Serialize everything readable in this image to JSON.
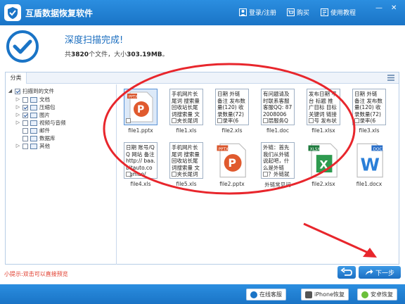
{
  "app": {
    "title": "互盾数据恢复软件"
  },
  "toolbar": {
    "login": "登录/注册",
    "buy": "购买",
    "tutorial": "使用教程"
  },
  "status": {
    "title": "深度扫描完成!",
    "prefix": "共",
    "file_count": "3820",
    "mid": "个文件，大小",
    "size": "303.19MB",
    "suffix": "。"
  },
  "tabs": {
    "category": "分类"
  },
  "tree": {
    "root": "扫描到的文件",
    "items": [
      "文档",
      "压缩包",
      "图片",
      "视频与音频",
      "邮件",
      "数据库",
      "其他"
    ]
  },
  "files": [
    {
      "name": "file1.pptx",
      "type": "pptx",
      "snippet": ""
    },
    {
      "name": "file1.xls",
      "type": "text",
      "snippet": "手机网片长尾词 搜索量 回收站长尾词搜索量 文件夹长尾词"
    },
    {
      "name": "file2.xls",
      "type": "text",
      "snippet": "日期 外链 备注 发布数量(120) 收录数量(72) 收录率(6"
    },
    {
      "name": "file1.doc",
      "type": "text",
      "snippet": "有问题请及时联系客服 客服QQ: 872008006 三层服务QQ:"
    },
    {
      "name": "file1.xlsx",
      "type": "text",
      "snippet": "发布日期 平台 标题 推广目标 目标关键词 链接 账号 发布状态"
    },
    {
      "name": "file3.xls",
      "type": "text",
      "snippet": "日期 外链 备注 发布数量(120) 收录数量(72) 收录率(6"
    },
    {
      "name": "file4.xls",
      "type": "text",
      "snippet": "日期 账号/QQ 网站 备注 http:// baa.bitauto.co ngmao/"
    },
    {
      "name": "file5.xls",
      "type": "text",
      "snippet": "手机网片长尾词 搜索量 回收站长尾词搜索量 文件夹长尾词"
    },
    {
      "name": "file2.pptx",
      "type": "pptx",
      "snippet": ""
    },
    {
      "name": "外链常见问",
      "type": "text",
      "snippet": "外链：首先我们从外链说起吧，什么是外链呢？外链就是在"
    },
    {
      "name": "file2.xlsx",
      "type": "xlsx",
      "snippet": ""
    },
    {
      "name": "file1.docx",
      "type": "docx",
      "snippet": ""
    }
  ],
  "hint": "小提示:双击可以直接预览",
  "nav": {
    "next": "下一步"
  },
  "footer": {
    "service": "在线客服",
    "iphone": "iPhone恢复",
    "android": "安卓恢复"
  },
  "colors": {
    "brand_blue": "#1a74c6",
    "accent_red": "#e03a2a",
    "annot_red": "#e8262c"
  }
}
